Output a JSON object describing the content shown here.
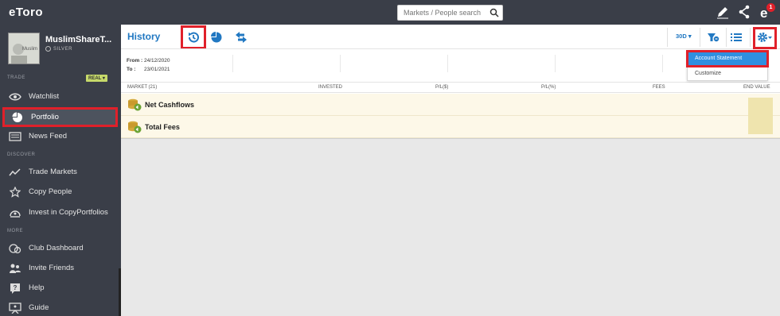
{
  "brand": {
    "logo_text": "eToro"
  },
  "search": {
    "placeholder": "Markets / People search"
  },
  "topbar": {
    "notification_count": "1"
  },
  "profile": {
    "username": "MuslimShareT...",
    "tier": "SILVER",
    "avatar_text": "Muslim"
  },
  "sidebar": {
    "trade_section": "TRADE",
    "account_mode": "REAL",
    "discover_section": "DISCOVER",
    "more_section": "MORE",
    "items": [
      {
        "label": "Watchlist",
        "icon": "watchlist-icon"
      },
      {
        "label": "Portfolio",
        "icon": "portfolio-pie-icon"
      },
      {
        "label": "News Feed",
        "icon": "news-feed-icon"
      },
      {
        "label": "Trade Markets",
        "icon": "trade-markets-icon"
      },
      {
        "label": "Copy People",
        "icon": "star-icon"
      },
      {
        "label": "Invest in CopyPortfolios",
        "icon": "copyportfolios-icon"
      },
      {
        "label": "Club Dashboard",
        "icon": "club-dashboard-icon"
      },
      {
        "label": "Invite Friends",
        "icon": "invite-friends-icon"
      },
      {
        "label": "Help",
        "icon": "help-icon"
      },
      {
        "label": "Guide",
        "icon": "guide-icon"
      }
    ]
  },
  "main": {
    "title": "History",
    "period": "30D",
    "dates": {
      "from_label": "From :",
      "from_value": "24/12/2020",
      "to_label": "To :",
      "to_value": "23/01/2021"
    },
    "columns": [
      "MARKET (21)",
      "INVESTED",
      "P/L($)",
      "P/L(%)",
      "FEES",
      "END VALUE"
    ],
    "rows": [
      {
        "label": "Net Cashflows"
      },
      {
        "label": "Total Fees"
      }
    ]
  },
  "settings_menu": {
    "items": [
      "Account Statement",
      "Customize"
    ]
  },
  "colors": {
    "accent": "#2178c2",
    "highlight": "#e0202a",
    "sidebar_bg": "#3a3e48",
    "row_bg": "#fdf8e8"
  }
}
